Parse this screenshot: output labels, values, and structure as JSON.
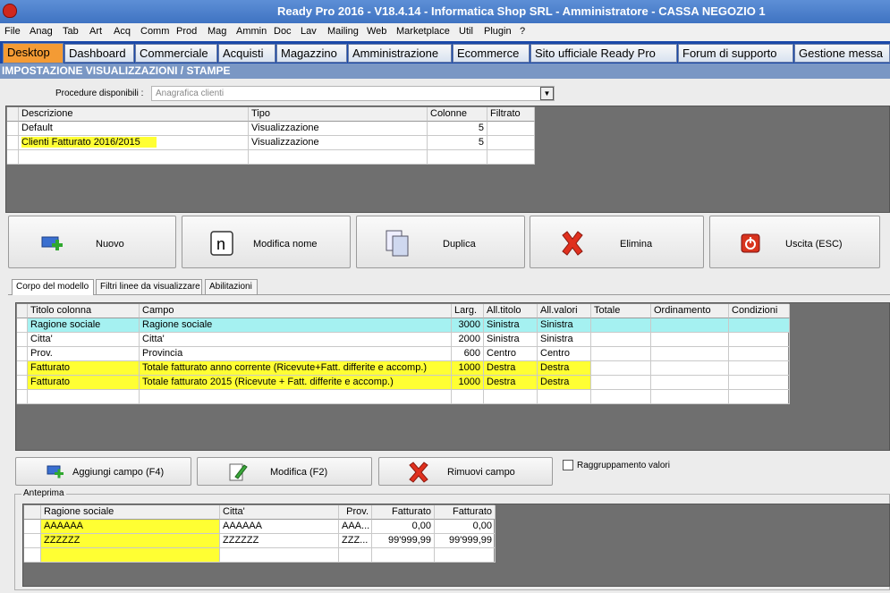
{
  "window": {
    "title": "Ready Pro 2016 - V18.4.14 - Informatica Shop SRL - Amministratore - CASSA NEGOZIO 1"
  },
  "menu": [
    "File",
    "Anag",
    "Tab",
    "Art",
    "Acq",
    "Comm",
    "Prod",
    "Mag",
    "Ammin",
    "Doc",
    "Lav",
    "Mailing",
    "Web",
    "Marketplace",
    "Util",
    "Plugin",
    "?"
  ],
  "tabs": [
    "Desktop",
    "Dashboard",
    "Commerciale",
    "Acquisti",
    "Magazzino",
    "Amministrazione",
    "Ecommerce",
    "Sito ufficiale Ready Pro",
    "Forum di supporto",
    "Gestione messa"
  ],
  "section_title": "IMPOSTAZIONE VISUALIZZAZIONI / STAMPE",
  "procedure": {
    "label": "Procedure disponibili :",
    "value": "Anagrafica clienti"
  },
  "views": {
    "headers": [
      "Descrizione",
      "Tipo",
      "Colonne",
      "Filtrato"
    ],
    "rows": [
      [
        "Default",
        "Visualizzazione",
        "5",
        ""
      ],
      [
        "Clienti Fatturato 2016/2015",
        "Visualizzazione",
        "5",
        ""
      ]
    ]
  },
  "buttons": {
    "nuovo": "Nuovo",
    "modifica_nome": "Modifica nome",
    "duplica": "Duplica",
    "elimina": "Elimina",
    "uscita": "Uscita (ESC)"
  },
  "subtabs": [
    "Corpo del modello",
    "Filtri linee da visualizzare",
    "Abilitazioni"
  ],
  "fields": {
    "headers": [
      "Titolo colonna",
      "Campo",
      "Larg.",
      "All.titolo",
      "All.valori",
      "Totale",
      "Ordinamento",
      "Condizioni"
    ],
    "rows": [
      [
        "Ragione sociale",
        "Ragione sociale",
        "3000",
        "Sinistra",
        "Sinistra",
        "",
        "",
        ""
      ],
      [
        "Citta'",
        "Citta'",
        "2000",
        "Sinistra",
        "Sinistra",
        "",
        "",
        ""
      ],
      [
        "Prov.",
        "Provincia",
        "600",
        "Centro",
        "Centro",
        "",
        "",
        ""
      ],
      [
        "Fatturato",
        "Totale fatturato anno corrente (Ricevute+Fatt. differite e accomp.)",
        "1000",
        "Destra",
        "Destra",
        "",
        "",
        ""
      ],
      [
        "Fatturato",
        "Totale fatturato 2015 (Ricevute + Fatt. differite e accomp.)",
        "1000",
        "Destra",
        "Destra",
        "",
        "",
        ""
      ]
    ]
  },
  "field_buttons": {
    "aggiungi": "Aggiungi campo (F4)",
    "modifica": "Modifica (F2)",
    "rimuovi": "Rimuovi campo"
  },
  "grouping": {
    "label": "Raggruppamento valori",
    "checked": false
  },
  "preview": {
    "label": "Anteprima",
    "headers": [
      "Ragione sociale",
      "Citta'",
      "Prov.",
      "Fatturato",
      "Fatturato"
    ],
    "rows": [
      [
        "AAAAAA",
        "AAAAAA",
        "AAA...",
        "0,00",
        "0,00"
      ],
      [
        "ZZZZZZ",
        "ZZZZZZ",
        "ZZZ...",
        "99'999,99",
        "99'999,99"
      ]
    ]
  }
}
